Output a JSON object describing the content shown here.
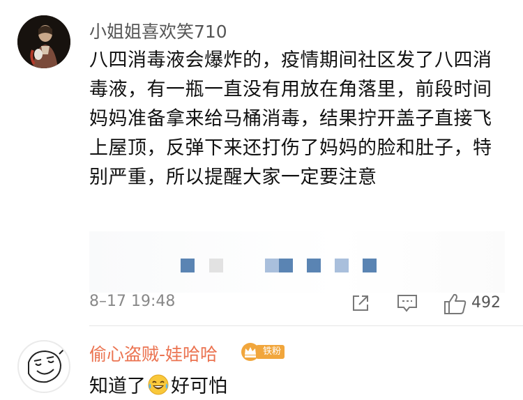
{
  "comment": {
    "username": "小姐姐喜欢笑710",
    "body": "八四消毒液会爆炸的，疫情期间社区发了八四消毒液，有一瓶一直没有用放在角落里，前段时间妈妈准备拿来给马桶消毒，结果拧开盖子直接飞上屋顶，反弹下来还打伤了妈妈的脸和肚子，特别严重，所以提醒大家一定要注意",
    "timestamp": "8–17 19:48",
    "like_count": "492",
    "icons": [
      "share-icon",
      "comment-icon",
      "like-icon"
    ]
  },
  "reply": {
    "username": "偷心盗贼-娃哈哈",
    "badge_label": "铁粉",
    "text_before": "知道了",
    "emoji": "laughing-crying-emoji",
    "text_after": "好可怕"
  },
  "colors": {
    "username_gray": "#555555",
    "reply_name_orange": "#eb7350",
    "badge_gold": "#f1a63c",
    "tile_blue": "#5a84b3",
    "tile_light_blue": "#a9bfdc",
    "tile_gray": "#e2e2e2"
  }
}
